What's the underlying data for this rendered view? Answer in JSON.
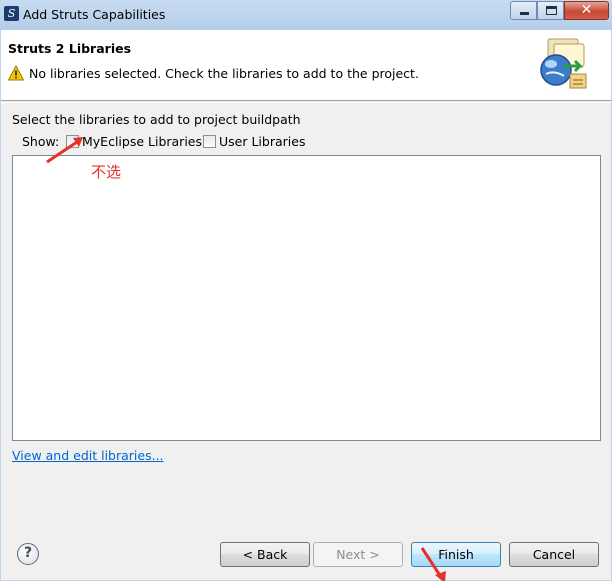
{
  "window": {
    "title": "Add Struts Capabilities",
    "controls": {
      "minimize": "minimize",
      "maximize": "maximize",
      "close": "✕"
    }
  },
  "header": {
    "title": "Struts 2 Libraries",
    "message": "No libraries selected. Check the libraries to add to the project."
  },
  "body": {
    "instruction": "Select the libraries to add to project buildpath",
    "show_label": "Show:",
    "checkboxes": [
      {
        "label": "MyEclipse Libraries",
        "checked": false
      },
      {
        "label": "User Libraries",
        "checked": false
      }
    ],
    "annotation": "不选",
    "library_items": [],
    "link": "View and edit libraries..."
  },
  "footer": {
    "help": "?",
    "back": "< Back",
    "next": "Next >",
    "finish": "Finish",
    "cancel": "Cancel"
  },
  "colors": {
    "annotation": "#e5312a",
    "link": "#0066cc",
    "titlebar": "#bcd4ec"
  }
}
